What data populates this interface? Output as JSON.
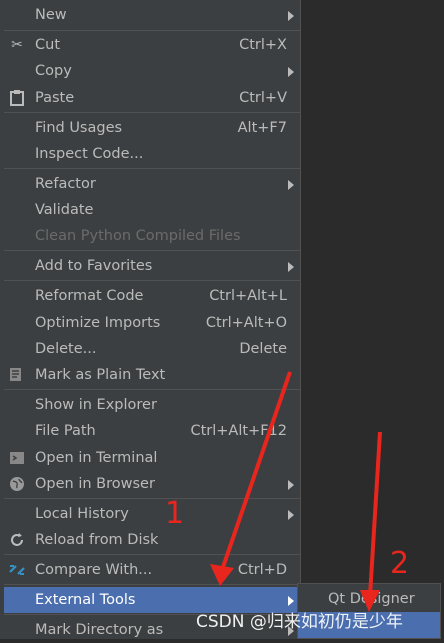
{
  "menu": {
    "items": [
      {
        "label": "New",
        "shortcut": "",
        "submenu": true,
        "icon": "",
        "disabled": false
      },
      {
        "label": "Cut",
        "shortcut": "Ctrl+X",
        "submenu": false,
        "icon": "scissors-icon",
        "disabled": false
      },
      {
        "label": "Copy",
        "shortcut": "",
        "submenu": true,
        "icon": "",
        "disabled": false
      },
      {
        "label": "Paste",
        "shortcut": "Ctrl+V",
        "submenu": false,
        "icon": "clipboard-icon",
        "disabled": false
      },
      {
        "label": "Find Usages",
        "shortcut": "Alt+F7",
        "submenu": false,
        "icon": "",
        "disabled": false
      },
      {
        "label": "Inspect Code...",
        "shortcut": "",
        "submenu": false,
        "icon": "",
        "disabled": false
      },
      {
        "label": "Refactor",
        "shortcut": "",
        "submenu": true,
        "icon": "",
        "disabled": false
      },
      {
        "label": "Validate",
        "shortcut": "",
        "submenu": false,
        "icon": "",
        "disabled": false
      },
      {
        "label": "Clean Python Compiled Files",
        "shortcut": "",
        "submenu": false,
        "icon": "",
        "disabled": true
      },
      {
        "label": "Add to Favorites",
        "shortcut": "",
        "submenu": true,
        "icon": "",
        "disabled": false
      },
      {
        "label": "Reformat Code",
        "shortcut": "Ctrl+Alt+L",
        "submenu": false,
        "icon": "",
        "disabled": false
      },
      {
        "label": "Optimize Imports",
        "shortcut": "Ctrl+Alt+O",
        "submenu": false,
        "icon": "",
        "disabled": false
      },
      {
        "label": "Delete...",
        "shortcut": "Delete",
        "submenu": false,
        "icon": "",
        "disabled": false
      },
      {
        "label": "Mark as Plain Text",
        "shortcut": "",
        "submenu": false,
        "icon": "plain-text-icon",
        "disabled": false
      },
      {
        "label": "Show in Explorer",
        "shortcut": "",
        "submenu": false,
        "icon": "",
        "disabled": false
      },
      {
        "label": "File Path",
        "shortcut": "Ctrl+Alt+F12",
        "submenu": false,
        "icon": "",
        "disabled": false
      },
      {
        "label": "Open in Terminal",
        "shortcut": "",
        "submenu": false,
        "icon": "terminal-icon",
        "disabled": false
      },
      {
        "label": "Open in Browser",
        "shortcut": "",
        "submenu": true,
        "icon": "globe-icon",
        "disabled": false
      },
      {
        "label": "Local History",
        "shortcut": "",
        "submenu": true,
        "icon": "",
        "disabled": false
      },
      {
        "label": "Reload from Disk",
        "shortcut": "",
        "submenu": false,
        "icon": "reload-icon",
        "disabled": false
      },
      {
        "label": "Compare With...",
        "shortcut": "Ctrl+D",
        "submenu": false,
        "icon": "compare-icon",
        "disabled": false
      },
      {
        "label": "External Tools",
        "shortcut": "",
        "submenu": true,
        "icon": "",
        "disabled": false,
        "selected": true
      },
      {
        "label": "Mark Directory as",
        "shortcut": "",
        "submenu": true,
        "icon": "",
        "disabled": false
      }
    ]
  },
  "submenu": {
    "items": [
      {
        "label": "Qt Designer"
      }
    ]
  },
  "annotations": {
    "label_1": "1",
    "label_2": "2",
    "arrow_color": "#e8261e"
  },
  "watermark": "CSDN @归来如初仍是少年",
  "colors": {
    "menu_bg": "#3c3f41",
    "selected_bg": "#4b6eaf",
    "text": "#bbbbbb",
    "disabled_text": "#6b6b6b"
  }
}
